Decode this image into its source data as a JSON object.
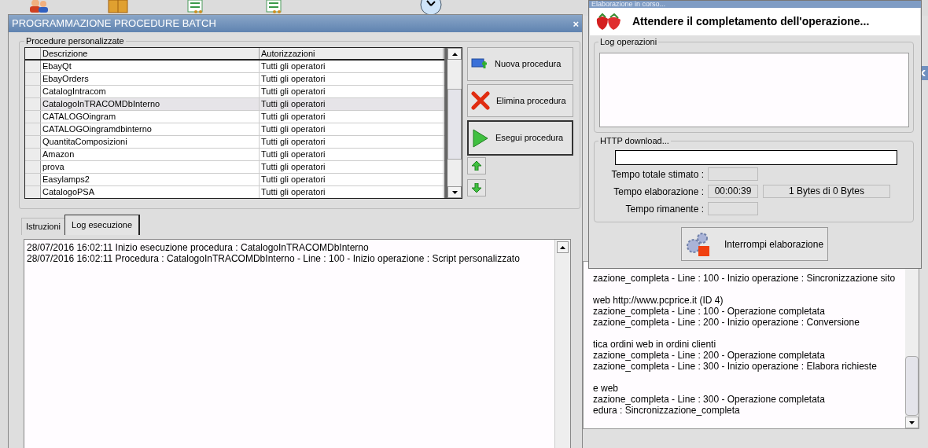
{
  "main_window": {
    "title": "PROGRAMMAZIONE PROCEDURE BATCH",
    "close": "×",
    "group_title": "Procedure personalizzate",
    "table": {
      "columns": [
        "Descrizione",
        "Autorizzazioni"
      ],
      "rows": [
        {
          "cells": [
            "EbayQt",
            "Tutti gli operatori"
          ],
          "selected": false
        },
        {
          "cells": [
            "EbayOrders",
            "Tutti gli operatori"
          ],
          "selected": false
        },
        {
          "cells": [
            "CatalogIntracom",
            "Tutti gli operatori"
          ],
          "selected": false
        },
        {
          "cells": [
            "CatalogoInTRACOMDbInterno",
            "Tutti gli operatori"
          ],
          "selected": true
        },
        {
          "cells": [
            "CATALOGOingram",
            "Tutti gli operatori"
          ],
          "selected": false
        },
        {
          "cells": [
            "CATALOGOingramdbinterno",
            "Tutti gli operatori"
          ],
          "selected": false
        },
        {
          "cells": [
            "QuantitaComposizioni",
            "Tutti gli operatori"
          ],
          "selected": false
        },
        {
          "cells": [
            "Amazon",
            "Tutti gli operatori"
          ],
          "selected": false
        },
        {
          "cells": [
            "prova",
            "Tutti gli operatori"
          ],
          "selected": false
        },
        {
          "cells": [
            "Easylamps2",
            "Tutti gli operatori"
          ],
          "selected": false
        },
        {
          "cells": [
            "CatalogoPSA",
            "Tutti gli operatori"
          ],
          "selected": false
        }
      ]
    },
    "buttons": [
      {
        "kind": "new",
        "label": "Nuova procedura",
        "focused": false
      },
      {
        "kind": "delete",
        "label": "Elimina procedura",
        "focused": false
      },
      {
        "kind": "run",
        "label": "Esegui procedura",
        "focused": true
      }
    ],
    "tabs": [
      {
        "label": "Istruzioni",
        "selected": false
      },
      {
        "label": "Log esecuzione",
        "selected": true
      }
    ],
    "log": [
      "28/07/2016 16:02:11 Inizio esecuzione procedura : CatalogoInTRACOMDbInterno",
      "28/07/2016 16:02:11 Procedura : CatalogoInTRACOMDbInterno - Line : 100 - Inizio operazione : Script personalizzato"
    ]
  },
  "background_log": [
    [
      "zazione_completa - Line : 100 - Inizio operazione : Sincronizzazione sito"
    ],
    [
      "web http://www.pcprice.it (ID 4)",
      "zazione_completa - Line : 100 - Operazione completata",
      "zazione_completa - Line : 200 - Inizio operazione : Conversione"
    ],
    [
      "tica ordini web in ordini clienti",
      "zazione_completa - Line : 200 - Operazione completata",
      "zazione_completa - Line : 300 - Inizio operazione : Elabora richieste"
    ],
    [
      "e web",
      "zazione_completa - Line : 300 - Operazione completata",
      "edura : Sincronizzazione_completa"
    ]
  ],
  "progress_dialog": {
    "title": "Elaborazione in corso...",
    "message": "Attendere il completamento dell'operazione...",
    "log_group": "Log operazioni",
    "http_group": "HTTP download...",
    "download": {
      "level": 0
    },
    "fields": [
      {
        "label": "Tempo totale stimato :"
      },
      {
        "label": "Tempo elaborazione :",
        "value": "00:00:39",
        "extra": "1 Bytes di 0 Bytes"
      },
      {
        "label": "Tempo rimanente :"
      }
    ],
    "stop_button": "Interrompi elaborazione"
  }
}
